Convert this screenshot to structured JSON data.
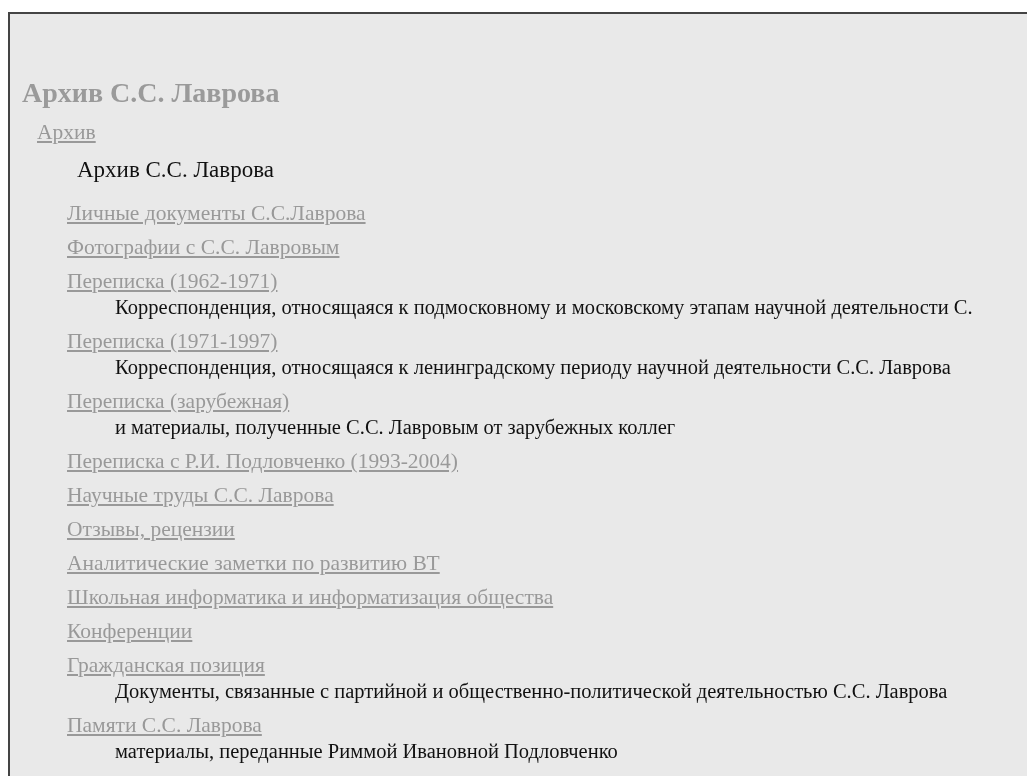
{
  "title": "Архив С.С. Лаврова",
  "breadcrumb": "Архив",
  "section_title": "Архив С.С. Лаврова",
  "items": [
    {
      "label": "Личные документы С.С.Лаврова"
    },
    {
      "label": "Фотографии с С.С. Лавровым"
    },
    {
      "label": "Переписка (1962-1971)",
      "description": "Корреспонденция, относящаяся к подмосковному и московскому этапам научной деятельности С."
    },
    {
      "label": "Переписка (1971-1997)",
      "description": "Корреспонденция, относящаяся к ленинградскому периоду научной деятельности С.С. Лаврова"
    },
    {
      "label": "Переписка (зарубежная)",
      "description": "и материалы, полученные С.С. Лавровым от зарубежных коллег"
    },
    {
      "label": "Переписка с Р.И. Подловченко (1993-2004)"
    },
    {
      "label": "Научные труды С.С. Лаврова"
    },
    {
      "label": "Отзывы, рецензии"
    },
    {
      "label": "Аналитические заметки по развитию ВТ"
    },
    {
      "label": "Школьная информатика и информатизация общества"
    },
    {
      "label": "Конференции"
    },
    {
      "label": "Гражданская позиция",
      "description": "Документы, связанные с партийной и общественно-политической деятельностью С.С. Лаврова"
    },
    {
      "label": "Памяти С.С. Лаврова",
      "description": "материалы, переданные Риммой Ивановной Подловченко"
    }
  ]
}
